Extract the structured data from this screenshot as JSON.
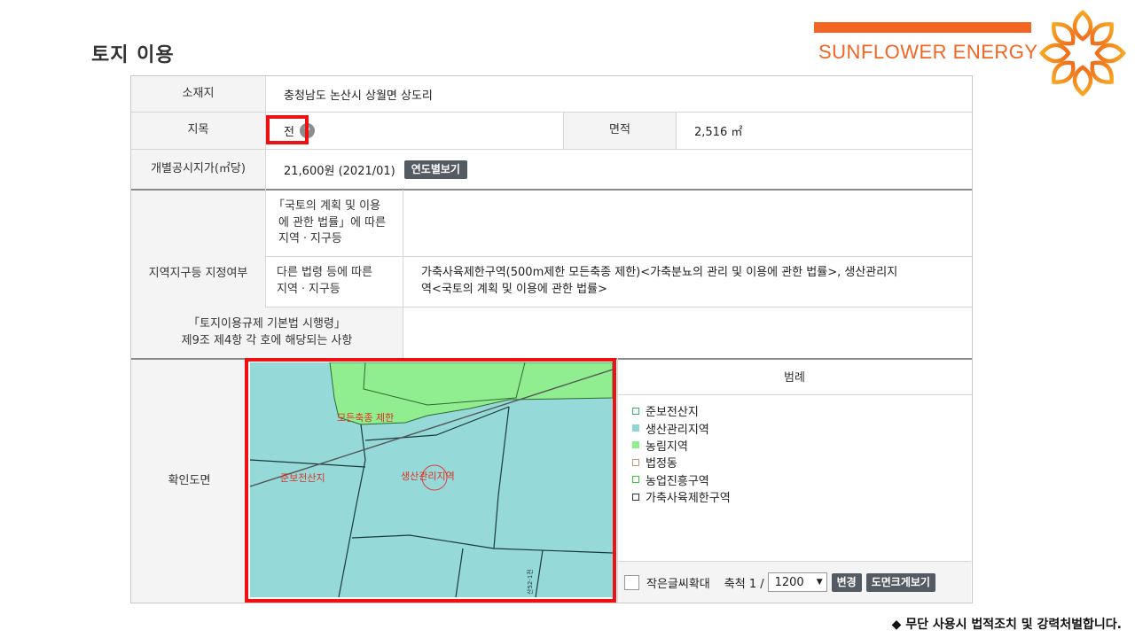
{
  "slide": {
    "title": "토지 이용"
  },
  "brand": {
    "name": "SUNFLOWER ENERGY",
    "color": "#f26522"
  },
  "table": {
    "location": {
      "label": "소재지",
      "value": "충청남도 논산시 상월면 상도리"
    },
    "land_category": {
      "label": "지목",
      "value": "전",
      "help_icon": "question-icon"
    },
    "area": {
      "label": "면적",
      "value": "2,516 ㎡"
    },
    "price": {
      "label": "개별공시지가(㎡당)",
      "value": "21,600원 (2021/01)",
      "button": "연도별보기"
    },
    "zoning": {
      "label": "지역지구등 지정여부",
      "national_label_1": "「국토의 계획 및 이용",
      "national_label_2": "에 관한 법률」에 따른",
      "national_label_3": "지역ㆍ지구등",
      "national_value": "",
      "other_label_1": "다른 법령 등에 따른",
      "other_label_2": "지역ㆍ지구등",
      "other_value_1": "가축사육제한구역(500m제한 모든축종 제한)<가축분뇨의 관리 및 이용에 관한 법률>, 생산관리지",
      "other_value_2": "역<국토의 계획 및 이용에 관한 법률>"
    },
    "regulation": {
      "label_1": "「토지이용규제 기본법 시행령」",
      "label_2": "제9조 제4항 각 호에 해당되는 사항",
      "value": ""
    },
    "map": {
      "label": "확인도면",
      "labels": {
        "restriction": "모든축종 제한",
        "reserve": "준보전산지",
        "production": "생산관리지역",
        "parcel": "산52-1전"
      }
    },
    "legend": {
      "title": "범례",
      "items": [
        {
          "label": "준보전산지",
          "fill": "#ffffff",
          "border": "#3cb371"
        },
        {
          "label": "생산관리지역",
          "fill": "#8fd6d6",
          "border": "#8fd6d6"
        },
        {
          "label": "농림지역",
          "fill": "#90ee90",
          "border": "#90ee90"
        },
        {
          "label": "법정동",
          "fill": "#ffffff",
          "border": "#b89a7a"
        },
        {
          "label": "농업진흥구역",
          "fill": "#ffffff",
          "border": "#33cc33"
        },
        {
          "label": "가축사육제한구역",
          "fill": "#ffffff",
          "border": "#333333"
        }
      ]
    },
    "map_tools": {
      "enlarge_label": "작은글씨확대",
      "scale_label": "축척 1 /",
      "scale_value": "1200",
      "change_button": "변경",
      "enlarge_map_button": "도면크게보기"
    }
  },
  "footer": {
    "note": "◆ 무단 사용시 법적조치 및 강력처벌합니다."
  }
}
